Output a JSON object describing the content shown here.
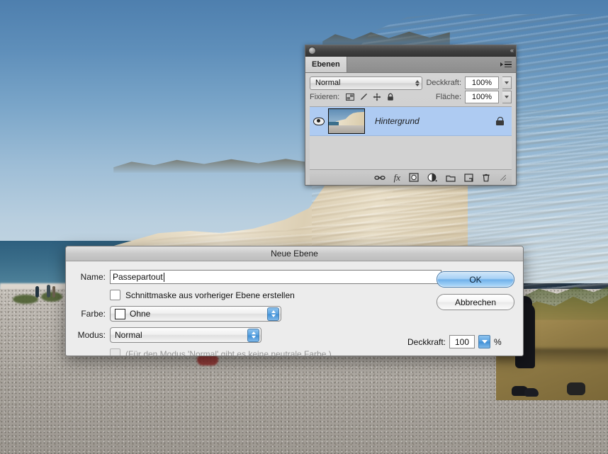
{
  "photo": {
    "description": "chalk cliff and pebble beach photograph",
    "sky_color": "#7ba6c9",
    "cliff_color": "#e4d8bf",
    "beach_color": "#b9b4ad",
    "sea_color": "#3a6d89"
  },
  "layers_panel": {
    "tab_label": "Ebenen",
    "collapse_glyph": "«",
    "blend_mode": "Normal",
    "opacity_label": "Deckkraft:",
    "opacity_value": "100%",
    "lock_label": "Fixieren:",
    "fill_label": "Fläche:",
    "fill_value": "100%",
    "lock_icons": [
      "lock-transparency-icon",
      "lock-image-icon",
      "lock-position-icon",
      "lock-all-icon"
    ],
    "layers": [
      {
        "name": "Hintergrund",
        "visible": true,
        "locked": true,
        "selected": true
      }
    ],
    "footer_icons": [
      "link-layers-icon",
      "layer-style-fx-icon",
      "add-layer-mask-icon",
      "adjustment-layer-icon",
      "new-group-icon",
      "new-layer-icon",
      "delete-layer-icon"
    ],
    "selection_color": "#aecbf2"
  },
  "dialog": {
    "title": "Neue Ebene",
    "name_label": "Name:",
    "name_value": "Passepartout",
    "clipping_mask_label": "Schnittmaske aus vorheriger Ebene erstellen",
    "clipping_mask_checked": false,
    "color_label": "Farbe:",
    "color_value": "Ohne",
    "mode_label": "Modus:",
    "mode_value": "Normal",
    "opacity_label": "Deckkraft:",
    "opacity_value": "100",
    "opacity_unit": "%",
    "neutral_note": "(Für den Modus 'Normal' gibt es keine neutrale Farbe.)",
    "neutral_checked": false,
    "neutral_disabled": true,
    "ok_label": "OK",
    "cancel_label": "Abbrechen",
    "default_button_color": "#6fb0ea"
  }
}
